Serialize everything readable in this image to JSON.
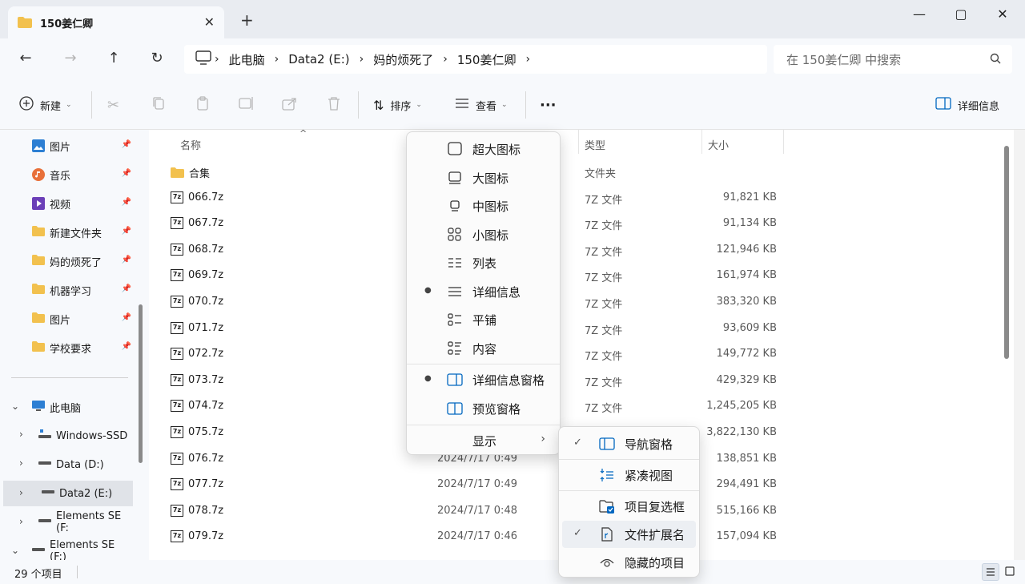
{
  "tab": {
    "title": "150姜仁卿"
  },
  "address": {
    "crumbs": [
      "此电脑",
      "Data2 (E:)",
      "妈的烦死了",
      "150姜仁卿"
    ]
  },
  "search": {
    "placeholder": "在 150姜仁卿 中搜索"
  },
  "toolbar": {
    "new_label": "新建",
    "sort_label": "排序",
    "view_label": "查看",
    "details_label": "详细信息"
  },
  "sidebar": {
    "quick": [
      {
        "label": "图片",
        "icon": "pictures-icon"
      },
      {
        "label": "音乐",
        "icon": "music-icon"
      },
      {
        "label": "视频",
        "icon": "video-icon"
      },
      {
        "label": "新建文件夹",
        "icon": "folder-icon"
      },
      {
        "label": "妈的烦死了",
        "icon": "folder-icon"
      },
      {
        "label": "机器学习",
        "icon": "folder-icon"
      },
      {
        "label": "图片",
        "icon": "folder-icon"
      },
      {
        "label": "学校要求",
        "icon": "folder-icon"
      }
    ],
    "tree": [
      {
        "label": "此电脑"
      },
      {
        "label": "Windows-SSD"
      },
      {
        "label": "Data (D:)"
      },
      {
        "label": "Data2 (E:)"
      },
      {
        "label": "Elements SE (F:"
      },
      {
        "label": "Elements SE (F:)"
      }
    ]
  },
  "list": {
    "columns": {
      "name": "名称",
      "type": "类型",
      "size": "大小"
    },
    "rows": [
      {
        "name": "合集",
        "date": "",
        "type": "文件夹",
        "size": ""
      },
      {
        "name": "066.7z",
        "date": "",
        "type": "7Z 文件",
        "size": "91,821 KB"
      },
      {
        "name": "067.7z",
        "date": "",
        "type": "7Z 文件",
        "size": "91,134 KB"
      },
      {
        "name": "068.7z",
        "date": "",
        "type": "7Z 文件",
        "size": "121,946 KB"
      },
      {
        "name": "069.7z",
        "date": "",
        "type": "7Z 文件",
        "size": "161,974 KB"
      },
      {
        "name": "070.7z",
        "date": "",
        "type": "7Z 文件",
        "size": "383,320 KB"
      },
      {
        "name": "071.7z",
        "date": "",
        "type": "7Z 文件",
        "size": "93,609 KB"
      },
      {
        "name": "072.7z",
        "date": "",
        "type": "7Z 文件",
        "size": "149,772 KB"
      },
      {
        "name": "073.7z",
        "date": "",
        "type": "7Z 文件",
        "size": "429,329 KB"
      },
      {
        "name": "074.7z",
        "date": "",
        "type": "7Z 文件",
        "size": "1,245,205 KB"
      },
      {
        "name": "075.7z",
        "date": "",
        "type": "",
        "size": "3,822,130 KB"
      },
      {
        "name": "076.7z",
        "date": "2024/7/17 0:49",
        "type": "",
        "size": "138,851 KB"
      },
      {
        "name": "077.7z",
        "date": "2024/7/17 0:49",
        "type": "",
        "size": "294,491 KB"
      },
      {
        "name": "078.7z",
        "date": "2024/7/17 0:48",
        "type": "",
        "size": "515,166 KB"
      },
      {
        "name": "079.7z",
        "date": "2024/7/17 0:46",
        "type": "",
        "size": "157,094 KB"
      }
    ]
  },
  "status": {
    "count": "29 个项目"
  },
  "view_menu": {
    "items": [
      {
        "label": "超大图标",
        "icon": "extra-large-icons-icon",
        "selected": false
      },
      {
        "label": "大图标",
        "icon": "large-icons-icon",
        "selected": false
      },
      {
        "label": "中图标",
        "icon": "medium-icons-icon",
        "selected": false
      },
      {
        "label": "小图标",
        "icon": "small-icons-icon",
        "selected": false
      },
      {
        "label": "列表",
        "icon": "list-icon",
        "selected": false
      },
      {
        "label": "详细信息",
        "icon": "details-icon",
        "selected": true
      },
      {
        "label": "平铺",
        "icon": "tiles-icon",
        "selected": false
      },
      {
        "label": "内容",
        "icon": "content-icon",
        "selected": false
      },
      {
        "label": "详细信息窗格",
        "icon": "details-pane-icon",
        "selected": true
      },
      {
        "label": "预览窗格",
        "icon": "preview-pane-icon",
        "selected": false
      },
      {
        "label": "显示",
        "icon": "",
        "selected": false
      }
    ]
  },
  "show_menu": {
    "items": [
      {
        "label": "导航窗格",
        "icon": "navigation-pane-icon",
        "checked": true
      },
      {
        "label": "紧凑视图",
        "icon": "compact-view-icon",
        "checked": false
      },
      {
        "label": "项目复选框",
        "icon": "item-checkbox-icon",
        "checked": false
      },
      {
        "label": "文件扩展名",
        "icon": "file-extension-icon",
        "checked": true
      },
      {
        "label": "隐藏的项目",
        "icon": "hidden-items-icon",
        "checked": false
      }
    ]
  },
  "colors": {
    "folder": "#f2c14e",
    "accent": "#0067c0"
  }
}
